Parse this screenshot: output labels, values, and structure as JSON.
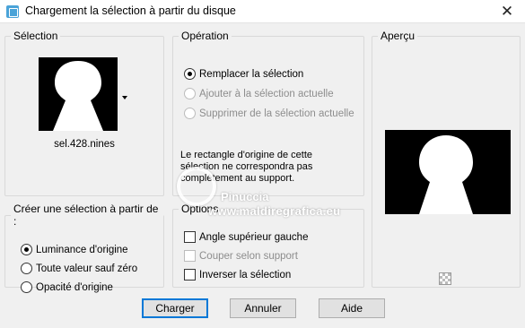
{
  "window": {
    "title": "Chargement la sélection à partir du disque",
    "close_glyph": "✕"
  },
  "selection": {
    "legend": "Sélection",
    "file_name": "sel.428.nines"
  },
  "operation": {
    "legend": "Opération",
    "options": [
      {
        "label": "Remplacer la sélection",
        "checked": true,
        "disabled": false
      },
      {
        "label": "Ajouter à la sélection actuelle",
        "checked": false,
        "disabled": true
      },
      {
        "label": "Supprimer de la sélection actuelle",
        "checked": false,
        "disabled": true
      }
    ],
    "info": "Le rectangle d'origine de cette sélection ne correspondra pas complètement au support."
  },
  "preview": {
    "legend": "Aperçu"
  },
  "create_from": {
    "legend": "Créer une sélection à partir de :",
    "options": [
      {
        "label": "Luminance d'origine",
        "checked": true
      },
      {
        "label": "Toute valeur sauf zéro",
        "checked": false
      },
      {
        "label": "Opacité d'origine",
        "checked": false
      }
    ]
  },
  "options": {
    "legend": "Options",
    "items": [
      {
        "label": "Angle supérieur gauche",
        "checked": false,
        "disabled": false
      },
      {
        "label": "Couper selon support",
        "checked": false,
        "disabled": true
      },
      {
        "label": "Inverser la sélection",
        "checked": false,
        "disabled": false
      }
    ]
  },
  "buttons": {
    "load": "Charger",
    "cancel": "Annuler",
    "help": "Aide"
  },
  "watermark": {
    "line1": "Pinuccia",
    "line2": "www.maldiregrafica.eu"
  },
  "colors": {
    "accent": "#0078d7",
    "dialog_bg": "#f0f0f0",
    "disabled_text": "#8d8d8d"
  }
}
